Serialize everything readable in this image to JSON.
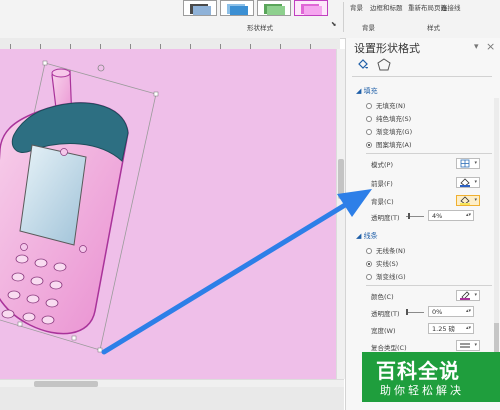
{
  "ribbon": {
    "group_label": "形状样式",
    "buttons": [
      "背景",
      "边框和标题",
      "重新布局页面",
      "连接线"
    ],
    "group_label_right": "背景",
    "group_label_right2": "样式"
  },
  "pane": {
    "title": "设置形状格式",
    "dropdown_caret": "▾",
    "close": "×",
    "fill_section": "填充",
    "fill_options": [
      {
        "label": "无填充(N)",
        "checked": false
      },
      {
        "label": "纯色填充(S)",
        "checked": false
      },
      {
        "label": "渐变填充(G)",
        "checked": false
      },
      {
        "label": "图案填充(A)",
        "checked": true
      }
    ],
    "pattern_label": "模式(P)",
    "foreground_label": "前景(F)",
    "background_label": "背景(C)",
    "fill_transparency_label": "透明度(T)",
    "fill_transparency_value": "4%",
    "line_section": "线条",
    "line_options": [
      {
        "label": "无线条(N)",
        "checked": false
      },
      {
        "label": "实线(S)",
        "checked": true
      },
      {
        "label": "渐变线(G)",
        "checked": false
      }
    ],
    "color_label": "颜色(C)",
    "line_transparency_label": "透明度(T)",
    "line_transparency_value": "0%",
    "width_label": "宽度(W)",
    "width_value": "1.25 磅",
    "compound_label": "复合类型(C)"
  },
  "watermark": {
    "title": "百科全说",
    "subtitle": "助你轻松解决"
  },
  "colors": {
    "canvas_pink": "#efbfe9",
    "arrow_blue": "#2d7fe8",
    "phone_pink": "#f2b0de",
    "phone_teal": "#2d6f82",
    "watermark_green": "#1f9e3d"
  }
}
